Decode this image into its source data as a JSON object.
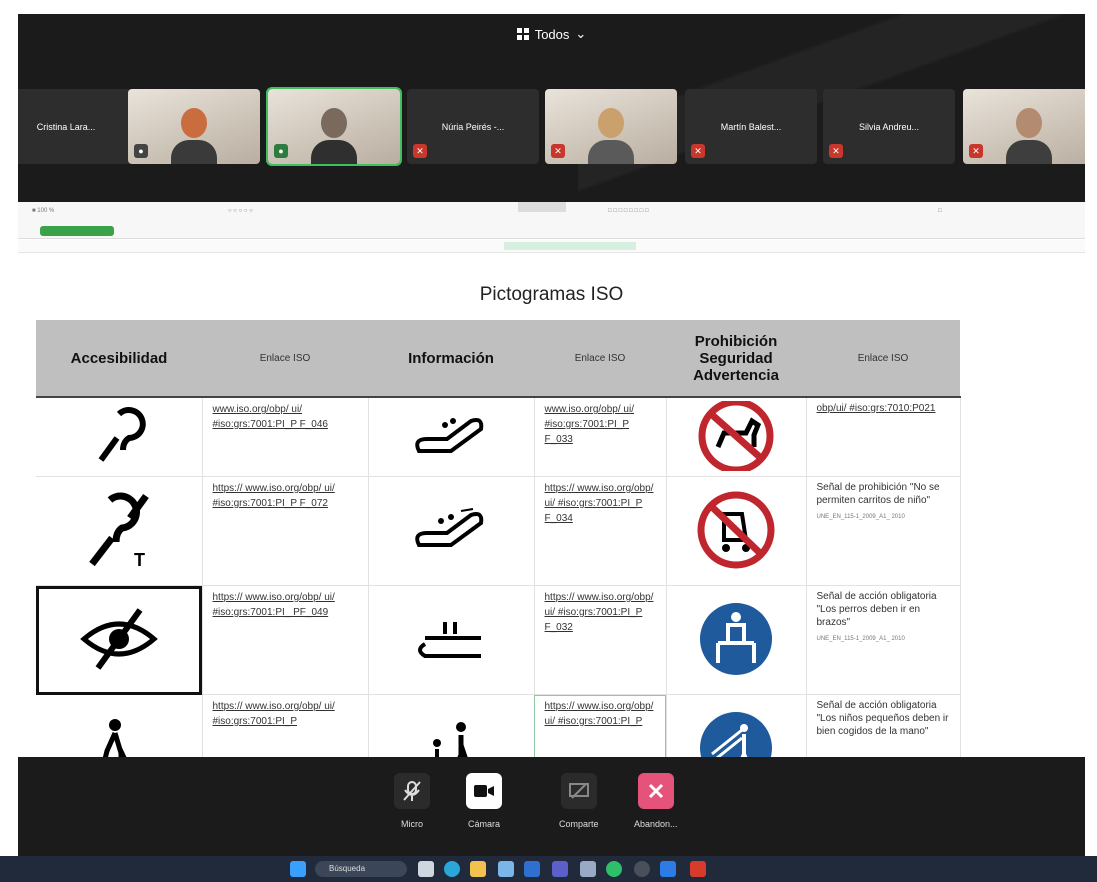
{
  "meeting": {
    "view_label": "Todos",
    "participants": [
      {
        "name": "Cristina Lara..."
      },
      {
        "name": ""
      },
      {
        "name": ""
      },
      {
        "name": "Núria Peirés -..."
      },
      {
        "name": ""
      },
      {
        "name": "Martín Balest..."
      },
      {
        "name": "Silvia Andreu..."
      },
      {
        "name": ""
      }
    ]
  },
  "sheet": {
    "title": "Pictogramas ISO",
    "headers": [
      "Accesibilidad",
      "Enlace ISO",
      "Información",
      "Enlace ISO",
      "Prohibición Seguridad Advertencia",
      "Enlace ISO"
    ],
    "rows": [
      {
        "link1": "www.iso.org/obp/ ui/ #iso:grs:7001:PI_P F_046",
        "link2": "www.iso.org/obp/ ui/ #iso:grs:7001:PI_P F_033",
        "desc": "obp/ui/ #iso:grs:7010:P021",
        "small": ""
      },
      {
        "link1": "https:// www.iso.org/obp/ ui/ #iso:grs:7001:PI_P F_072",
        "link2": "https:// www.iso.org/obp/ ui/ #iso:grs:7001:PI_P F_034",
        "desc": "Señal de prohibición \"No se permiten carritos de niño\"",
        "small": "UNE_EN_115-1_2009_A1_ 2010"
      },
      {
        "link1": "https:// www.iso.org/obp/ ui/ #iso:grs:7001:PI_ PF_049",
        "link2": "https:// www.iso.org/obp/ ui/ #iso:grs:7001:PI_P F_032",
        "desc": "Señal de acción obligatoria \"Los perros deben ir en brazos\"",
        "small": "UNE_EN_115-1_2009_A1_ 2010"
      },
      {
        "link1": "https:// www.iso.org/obp/ ui/ #iso:grs:7001:PI_P",
        "link2": "https:// www.iso.org/obp/ ui/ #iso:grs:7001:PI_P",
        "desc": "Señal de acción obligatoria \"Los niños pequeños deben ir bien cogidos de la mano\"",
        "small": ""
      }
    ]
  },
  "controls": {
    "mic": "Micro",
    "camera": "Cámara",
    "share": "Comparte",
    "leave": "Abandon..."
  },
  "taskbar": {
    "search": "Búsqueda"
  },
  "colors": {
    "zoom_bg": "#1b1b1b",
    "active_speaker": "#3fbf5d",
    "leave": "#e5527a",
    "header_gray": "#bfbfbf"
  }
}
